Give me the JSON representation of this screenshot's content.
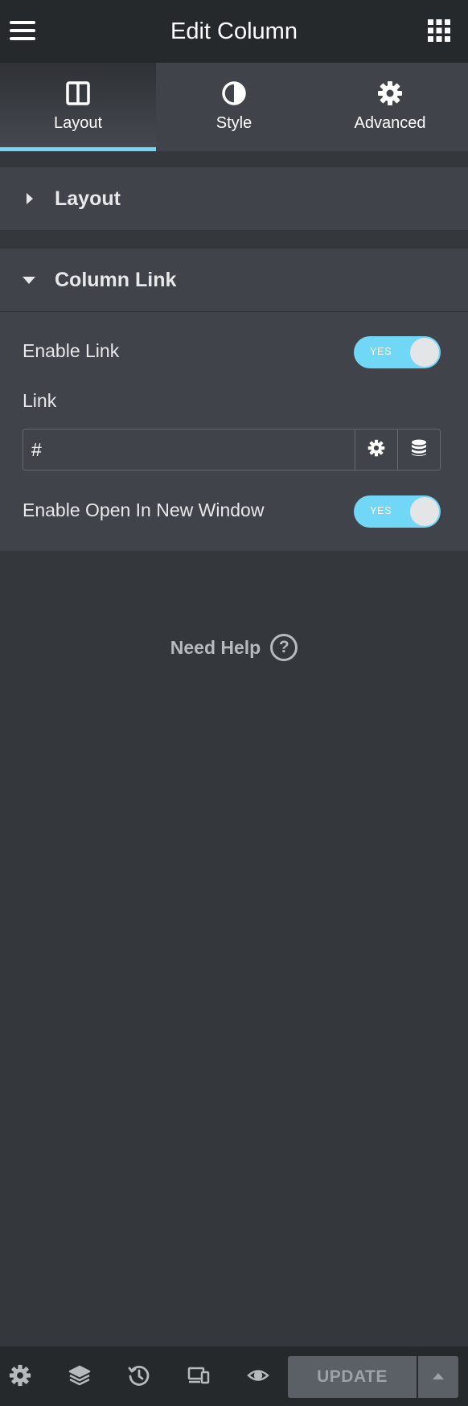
{
  "header": {
    "title": "Edit Column",
    "menu_icon": "hamburger-icon",
    "grid_icon": "grid-icon"
  },
  "tabs": [
    {
      "label": "Layout",
      "icon": "columns-icon",
      "active": true
    },
    {
      "label": "Style",
      "icon": "contrast-icon",
      "active": false
    },
    {
      "label": "Advanced",
      "icon": "gear-icon",
      "active": false
    }
  ],
  "sections": {
    "layout": {
      "label": "Layout",
      "expanded": false
    },
    "column_link": {
      "label": "Column Link",
      "expanded": true,
      "enable_link": {
        "label": "Enable Link",
        "state": "YES"
      },
      "link": {
        "label": "Link",
        "value": "#"
      },
      "new_window": {
        "label": "Enable Open In New Window",
        "state": "YES"
      }
    }
  },
  "help": {
    "label": "Need Help",
    "icon_glyph": "?"
  },
  "footer": {
    "icons": [
      "gear-icon",
      "layers-icon",
      "history-icon",
      "responsive-icon",
      "eye-icon"
    ],
    "update_label": "UPDATE"
  },
  "colors": {
    "accent": "#71d7f7",
    "panel": "#404349",
    "background": "#34373c",
    "header": "#26292c"
  }
}
